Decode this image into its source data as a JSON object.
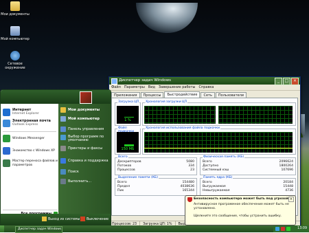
{
  "desktop": {
    "icons": [
      {
        "label": "Мои документы"
      },
      {
        "label": "Мой компьютер"
      },
      {
        "label": "Сетевое окружение"
      }
    ]
  },
  "taskmgr": {
    "title": "Диспетчер задач Windows",
    "menu": [
      "Файл",
      "Параметры",
      "Вид",
      "Завершение работы",
      "Справка"
    ],
    "tabs": [
      "Приложения",
      "Процессы",
      "Быстродействие",
      "Сеть",
      "Пользователи"
    ],
    "active_tab": "Быстродействие",
    "cpu_label": "Загрузка ЦП",
    "cpu_value": "1 %",
    "cpu_history_label": "Хронология загрузки ЦП",
    "pf_label": "Файл подкачки",
    "pf_value": "150 МБ",
    "pf_history_label": "Хронология использования файла подкачки",
    "totals": {
      "title": "Всего",
      "rows": [
        [
          "Дескрипторов",
          "5080"
        ],
        [
          "Потоков",
          "334"
        ],
        [
          "Процессов",
          "23"
        ]
      ]
    },
    "physical": {
      "title": "Физическая память (КБ)",
      "rows": [
        [
          "Всего",
          "2096624"
        ],
        [
          "Доступно",
          "1800264"
        ],
        [
          "Системный кэш",
          "107696"
        ]
      ]
    },
    "commit": {
      "title": "Выделение памяти (КБ)",
      "rows": [
        [
          "Всего",
          "154480"
        ],
        [
          "Предел",
          "4038636"
        ],
        [
          "Пик",
          "165344"
        ]
      ]
    },
    "kernel": {
      "title": "Память ядра (КБ)",
      "rows": [
        [
          "Всего",
          "20184"
        ],
        [
          "Выгружаемая",
          "15448"
        ],
        [
          "Невыгружаемая",
          "4736"
        ]
      ]
    },
    "status": [
      "Процессов: 23",
      "Загрузка ЦП: 1%",
      "Выделение памяти: 150МБ / 3944МБ"
    ]
  },
  "start_menu": {
    "pinned": [
      {
        "title": "Интернет",
        "sub": "Internet Explorer",
        "color": "#1e6fd0"
      },
      {
        "title": "Электронная почта",
        "sub": "Outlook Express",
        "color": "#3a8ad8"
      }
    ],
    "recent": [
      {
        "title": "Windows Messenger",
        "color": "#2a9a3a"
      },
      {
        "title": "Знакомство с Windows XP",
        "color": "#2c6ad0"
      },
      {
        "title": "Мастер переноса файлов и параметров",
        "color": "#3a7a4a"
      }
    ],
    "all_programs": "Все программы",
    "right": [
      {
        "label": "Мои документы",
        "color": "#e8c040"
      },
      {
        "label": "Мой компьютер",
        "color": "#7fa7d8"
      },
      {
        "label": "Панель управления",
        "color": "#5a8ad0"
      },
      {
        "label": "Выбор программ по умолчанию",
        "color": "#4a9ad0"
      },
      {
        "label": "Принтеры и факсы",
        "color": "#8a8a8a"
      },
      {
        "label": "Справка и поддержка",
        "color": "#3a7ae0"
      },
      {
        "label": "Поиск",
        "color": "#4a8ac0"
      },
      {
        "label": "Выполнить...",
        "color": "#6a7a8a"
      }
    ],
    "logoff": "Выход из системы",
    "shutdown": "Выключение"
  },
  "taskbar": {
    "task_label": "Диспетчер задач Windows",
    "clock": "13:09"
  },
  "balloon": {
    "title": "Безопасность компьютера может быть под угрозой",
    "body": "Антивирусное программное обеспечение может быть не установлено.",
    "hint": "Щелкните это сообщение, чтобы устранить ошибку."
  }
}
